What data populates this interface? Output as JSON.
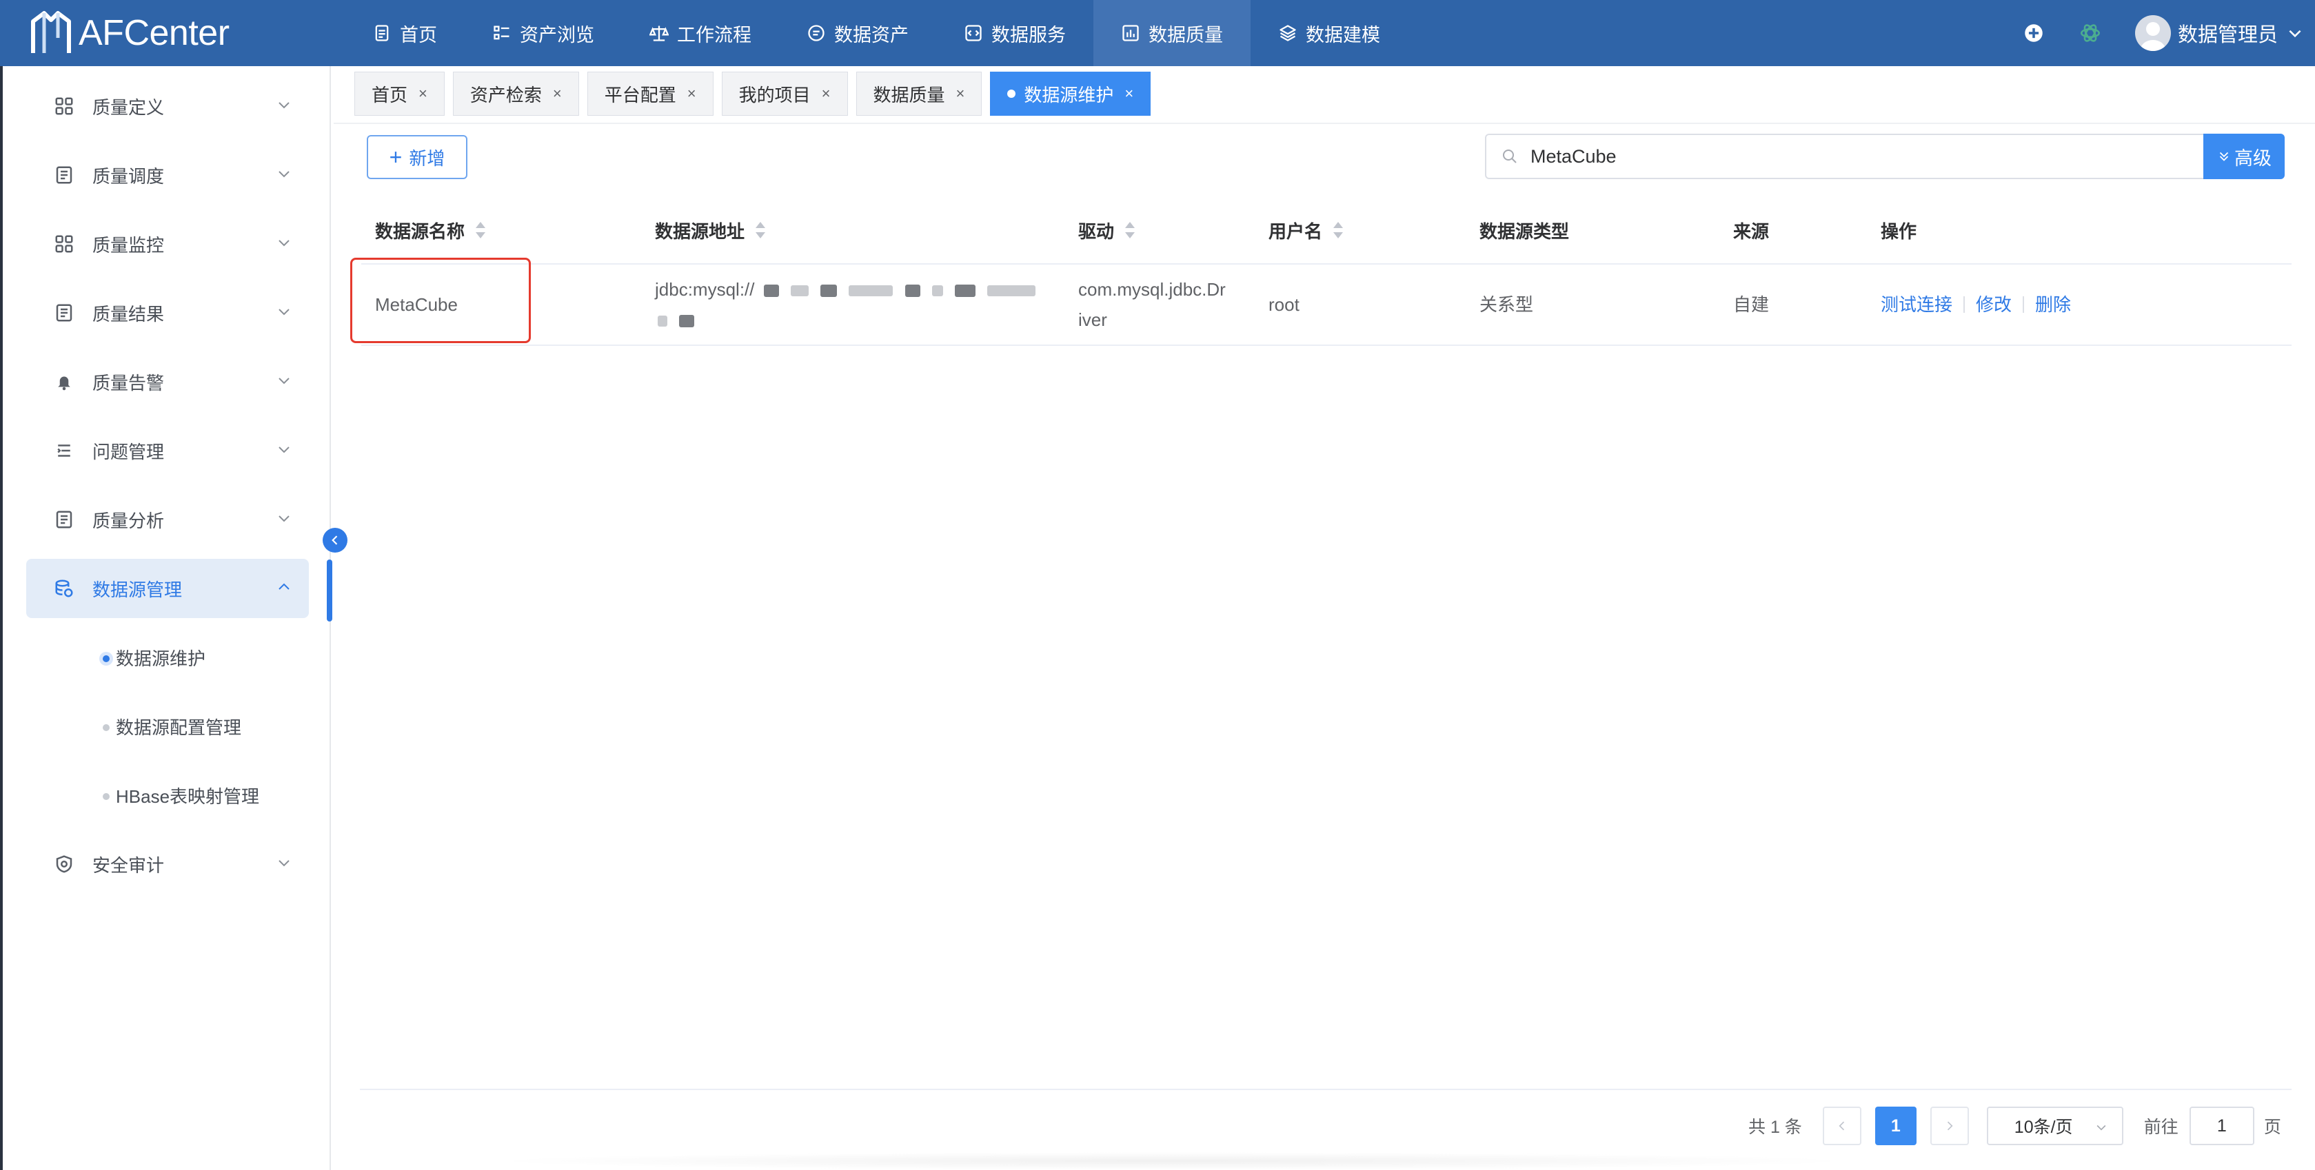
{
  "app": {
    "name": "AFCenter",
    "brand_color": "#2f64a8",
    "accent_color": "#3a8bf1",
    "highlight_color": "#e53a2e"
  },
  "topnav": [
    {
      "label": "首页",
      "icon": "document-icon"
    },
    {
      "label": "资产浏览",
      "icon": "list-icon"
    },
    {
      "label": "工作流程",
      "icon": "scale-icon"
    },
    {
      "label": "数据资产",
      "icon": "chat-box-icon"
    },
    {
      "label": "数据服务",
      "icon": "code-icon"
    },
    {
      "label": "数据质量",
      "icon": "bar-chart-icon",
      "active": true
    },
    {
      "label": "数据建模",
      "icon": "layers-icon"
    }
  ],
  "user": {
    "name": "数据管理员"
  },
  "sidebar": {
    "items": [
      {
        "label": "质量定义",
        "icon": "grid-icon"
      },
      {
        "label": "质量调度",
        "icon": "file-icon"
      },
      {
        "label": "质量监控",
        "icon": "grid-icon"
      },
      {
        "label": "质量结果",
        "icon": "file-icon"
      },
      {
        "label": "质量告警",
        "icon": "bell-icon"
      },
      {
        "label": "问题管理",
        "icon": "list-indent-icon"
      },
      {
        "label": "质量分析",
        "icon": "file-icon"
      },
      {
        "label": "数据源管理",
        "icon": "database-icon",
        "active": true
      },
      {
        "label": "安全审计",
        "icon": "shield-icon"
      }
    ],
    "subitems": [
      {
        "label": "数据源维护",
        "active": true
      },
      {
        "label": "数据源配置管理"
      },
      {
        "label": "HBase表映射管理"
      }
    ]
  },
  "tabs": [
    {
      "label": "首页"
    },
    {
      "label": "资产检索"
    },
    {
      "label": "平台配置"
    },
    {
      "label": "我的项目"
    },
    {
      "label": "数据质量"
    },
    {
      "label": "数据源维护",
      "active": true
    }
  ],
  "tab_close": "×",
  "toolbar": {
    "add_label": "新增",
    "search_value": "MetaCube",
    "advanced_label": "高级"
  },
  "table": {
    "columns": [
      "数据源名称",
      "数据源地址",
      "驱动",
      "用户名",
      "数据源类型",
      "来源",
      "操作"
    ],
    "rows": [
      {
        "name": "MetaCube",
        "address": "jdbc:mysql://",
        "driver_line1": "com.mysql.jdbc.Dr",
        "driver_line2": "iver",
        "username": "root",
        "type": "关系型",
        "source": "自建",
        "actions": [
          "测试连接",
          "修改",
          "删除"
        ]
      }
    ]
  },
  "pagination": {
    "total_text": "共 1 条",
    "current_page": "1",
    "page_size": "10条/页",
    "goto_prefix": "前往",
    "goto_value": "1",
    "goto_suffix": "页"
  }
}
